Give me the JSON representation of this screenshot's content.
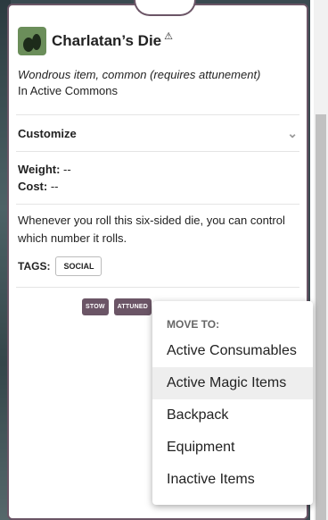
{
  "item": {
    "name": "Charlatan’s Die",
    "warning_icon": "warning-triangle-icon",
    "subtitle": "Wondrous item, common (requires attunement)",
    "location": "In Active Commons"
  },
  "customize": {
    "label": "Customize",
    "icon": "chevron-down-icon"
  },
  "stats": {
    "weight_label": "Weight:",
    "weight_value": "--",
    "cost_label": "Cost:",
    "cost_value": "--"
  },
  "description": "Whenever you roll this six-sided die, you can control which number it rolls.",
  "tags": {
    "label": "TAGS:",
    "items": [
      "SOCIAL"
    ]
  },
  "actions": {
    "stow": "STOW",
    "attuned": "ATTUNED"
  },
  "menu": {
    "header": "MOVE TO:",
    "items": [
      "Active Consumables",
      "Active Magic Items",
      "Backpack",
      "Equipment",
      "Inactive Items"
    ]
  },
  "colors": {
    "accent": "#6b5566",
    "icon_bg": "#6b8e5a"
  }
}
